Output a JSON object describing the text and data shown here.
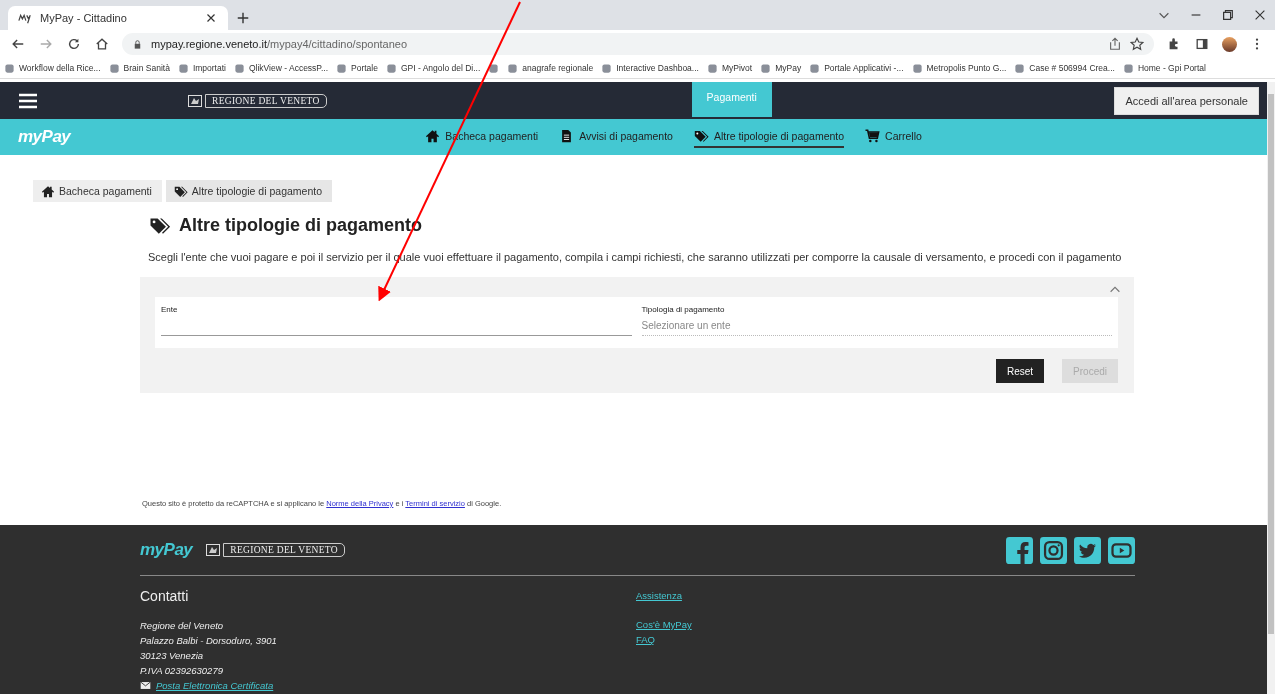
{
  "browser": {
    "tab_title": "MyPay - Cittadino",
    "url_host": "mypay.regione.veneto.it",
    "url_path": "/mypay4/cittadino/spontaneo",
    "bookmarks": [
      {
        "kind": "link",
        "label": "Workflow della Rice..."
      },
      {
        "kind": "link",
        "label": "Brain Sanità"
      },
      {
        "kind": "link",
        "label": "Importati"
      },
      {
        "kind": "link",
        "label": "QlikView - AccessP..."
      },
      {
        "kind": "link",
        "label": "Portale"
      },
      {
        "kind": "link",
        "label": "GPI - Angolo del Di..."
      },
      {
        "kind": "icon_only"
      },
      {
        "kind": "link",
        "label": "anagrafe regionale"
      },
      {
        "kind": "link",
        "label": "Interactive Dashboa..."
      },
      {
        "kind": "link",
        "label": "MyPivot"
      },
      {
        "kind": "link",
        "label": "MyPay"
      },
      {
        "kind": "link",
        "label": "Portale Applicativi -..."
      },
      {
        "kind": "link",
        "label": "Metropolis Punto G..."
      },
      {
        "kind": "link",
        "label": "Case # 506994 Crea..."
      },
      {
        "kind": "link",
        "label": "Home - Gpi Portal"
      }
    ]
  },
  "header": {
    "region_logo": "REGIONE DEL VENETO",
    "top_tabs": [
      {
        "label": "Pagamenti",
        "selected": true
      }
    ],
    "login_button": "Accedi all'area personale"
  },
  "brand": "myPay",
  "main_nav": [
    {
      "label": "Bacheca pagamenti",
      "selected": false
    },
    {
      "label": "Avvisi di pagamento",
      "selected": false
    },
    {
      "label": "Altre tipologie di pagamento",
      "selected": true
    },
    {
      "label": "Carrello",
      "selected": false
    }
  ],
  "breadcrumb": [
    {
      "label": "Bacheca pagamenti"
    },
    {
      "label": "Altre tipologie di pagamento"
    }
  ],
  "page": {
    "title": "Altre tipologie di pagamento",
    "description": "Scegli l'ente che vuoi pagare e poi il servizio per il quale vuoi effettuare il pagamento, compila i campi richiesti, che saranno utilizzati per comporre la causale di versamento, e procedi con il pagamento"
  },
  "form": {
    "expanded": true,
    "fields": [
      {
        "label": "Ente",
        "disabled": false
      },
      {
        "label": "Tipologia di pagamento",
        "placeholder": "Selezionare un ente",
        "disabled": true
      }
    ],
    "buttons": [
      {
        "label": "Reset",
        "disabled": false
      },
      {
        "label": "Procedi",
        "disabled": true
      }
    ]
  },
  "recaptcha_notice": [
    {
      "text": "Questo sito è protetto da reCAPTCHA e si applicano le "
    },
    {
      "link": "Norme della Privacy"
    },
    {
      "text": " e i "
    },
    {
      "link": "Termini di servizio"
    },
    {
      "text": " di Google."
    }
  ],
  "footer": {
    "brand": "myPay",
    "region_logo": "REGIONE DEL VENETO",
    "contacts_title": "Contatti",
    "address": [
      "Regione del Veneto",
      "Palazzo Balbi - Dorsoduro, 3901",
      "30123 Venezia",
      "P.IVA 02392630279"
    ],
    "pec_link": "Posta Elettronica Certificata",
    "assistance_title": "Assistenza",
    "assistance_links": [
      "Cos'è MyPay",
      "FAQ"
    ]
  }
}
